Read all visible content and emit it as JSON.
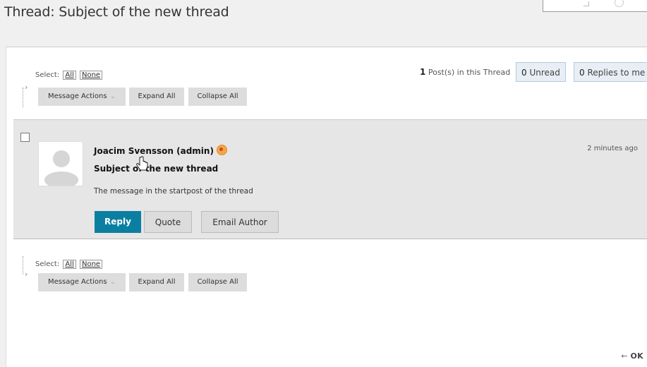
{
  "page": {
    "title": "Thread: Subject of the new thread"
  },
  "toolbar_top": {
    "select_label": "Select:",
    "all": "All",
    "none": "None",
    "message_actions": "Message Actions",
    "expand_all": "Expand All",
    "collapse_all": "Collapse All"
  },
  "thread_info": {
    "post_count": "1",
    "post_count_label": "Post(s) in this Thread",
    "unread_count": "0",
    "unread_label": "Unread",
    "replies_count": "0",
    "replies_label": "Replies to me"
  },
  "post": {
    "author": "Joacim Svensson (admin)",
    "time": "2 minutes ago",
    "subject": "Subject of the new thread",
    "message": "The message in the startpost of the thread",
    "reply_label": "Reply",
    "quote_label": "Quote",
    "email_label": "Email Author"
  },
  "toolbar_bottom": {
    "select_label": "Select:",
    "all": "All",
    "none": "None",
    "message_actions": "Message Actions",
    "expand_all": "Expand All",
    "collapse_all": "Collapse All"
  },
  "footer": {
    "ok_label": "OK",
    "arrow": "←"
  },
  "icons": [
    "chevron-down-icon",
    "badge-icon",
    "avatar-icon",
    "hand-cursor-icon",
    "arrow-left-icon"
  ],
  "colors": {
    "primary_button": "#0b7fa1",
    "post_background": "#e6e6e6",
    "count_box": "#e7eef5"
  }
}
